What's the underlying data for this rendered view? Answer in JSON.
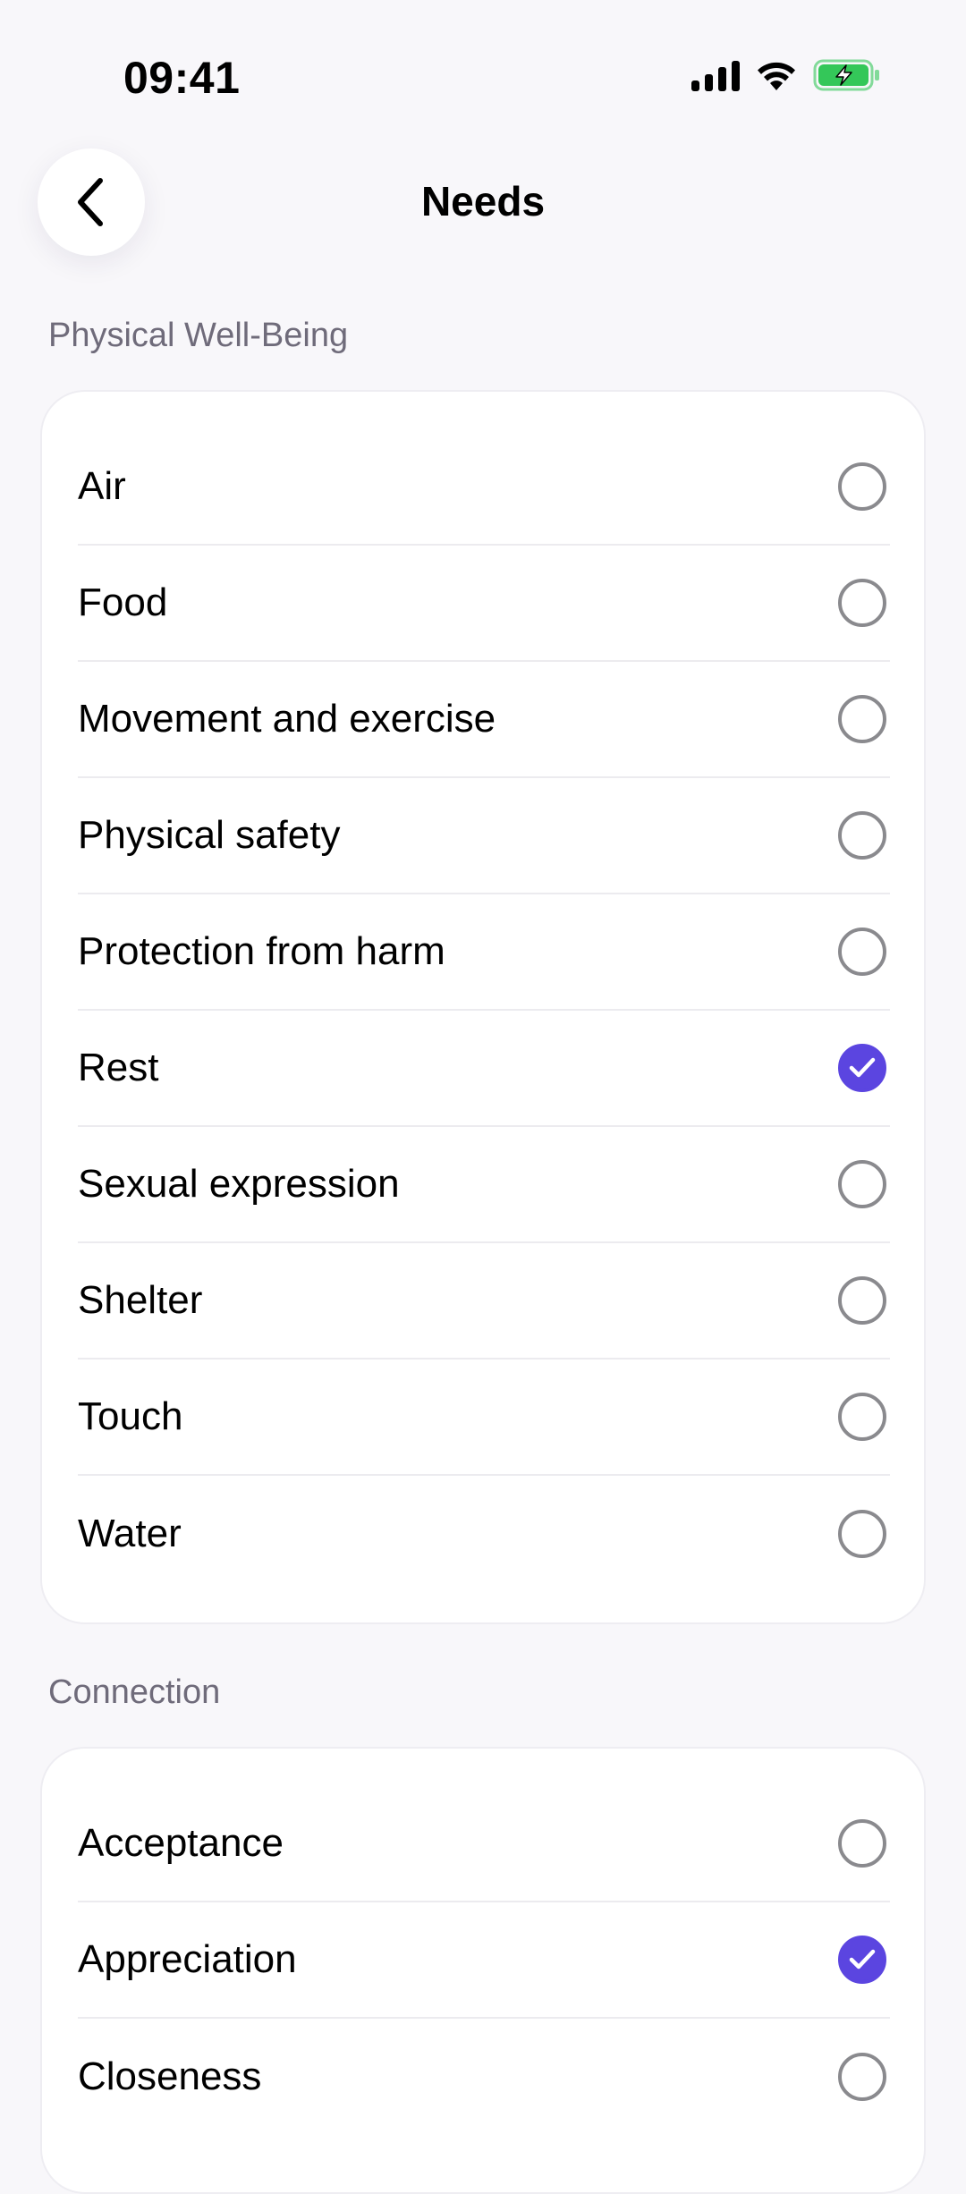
{
  "status_bar": {
    "time": "09:41"
  },
  "header": {
    "title": "Needs",
    "back_icon": "chevron-left-icon"
  },
  "colors": {
    "accent": "#5B45E0",
    "battery_fill": "#34C759"
  },
  "sections": [
    {
      "label": "Physical Well-Being",
      "items": [
        {
          "label": "Air",
          "checked": false
        },
        {
          "label": "Food",
          "checked": false
        },
        {
          "label": "Movement and exercise",
          "checked": false
        },
        {
          "label": "Physical safety",
          "checked": false
        },
        {
          "label": "Protection from harm",
          "checked": false
        },
        {
          "label": "Rest",
          "checked": true
        },
        {
          "label": "Sexual expression",
          "checked": false
        },
        {
          "label": "Shelter",
          "checked": false
        },
        {
          "label": "Touch",
          "checked": false
        },
        {
          "label": "Water",
          "checked": false
        }
      ]
    },
    {
      "label": "Connection",
      "items": [
        {
          "label": "Acceptance",
          "checked": false
        },
        {
          "label": "Appreciation",
          "checked": true
        },
        {
          "label": "Closeness",
          "checked": false
        }
      ]
    }
  ]
}
